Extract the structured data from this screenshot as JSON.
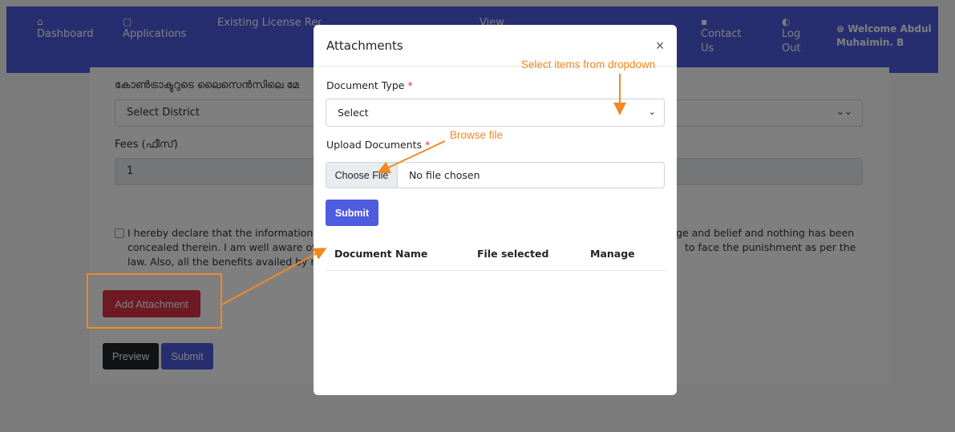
{
  "navbar": {
    "items": [
      {
        "icon": "home-icon",
        "glyph": "⌂",
        "label": "Dashboard"
      },
      {
        "icon": "applications-icon",
        "glyph": "▢",
        "label": "Applications"
      },
      {
        "icon": "license-icon",
        "glyph": "⌂",
        "label": "Existing License Registration"
      },
      {
        "icon": "view-icon",
        "glyph": "▤",
        "label": "View"
      },
      {
        "icon": "contact-icon",
        "glyph": "▪",
        "label": "Contact Us"
      },
      {
        "icon": "logout-icon",
        "glyph": "◐",
        "label": "Log Out"
      }
    ],
    "welcome": "Welcome Abdul Muhaimin. B"
  },
  "page": {
    "malayalam_text": "കോൺട്രാക്ടറുടെ ലൈസെൻസിലെ മേ",
    "district_placeholder": "Select District",
    "fees_label": "Fees (ഫീസ്)",
    "fees_value": "1",
    "declaration": [
      "I hereby declare that the information g",
      "ge and belief and nothing has been",
      "concealed therein. I am well aware of t",
      "to face the punishment as per the",
      "law. Also, all the benefits availed by m"
    ],
    "add_attachment_label": "Add Attachment",
    "preview_label": "Preview",
    "submit_label": "Submit"
  },
  "modal": {
    "title": "Attachments",
    "close_glyph": "×",
    "document_type_label": "Document Type",
    "required_mark": "*",
    "document_type_value": "Select",
    "upload_label": "Upload Documents",
    "choose_file_label": "Choose File",
    "no_file_text": "No file chosen",
    "submit_label": "Submit",
    "table_headers": [
      "Document Name",
      "File selected",
      "Manage"
    ]
  },
  "annotations": {
    "dropdown_hint": "Select items from dropdown",
    "browse_hint": "Browse file",
    "color": "#f08a24"
  },
  "colors": {
    "primary": "#4e5ce0",
    "danger": "#dc3545",
    "dark": "#212529"
  }
}
